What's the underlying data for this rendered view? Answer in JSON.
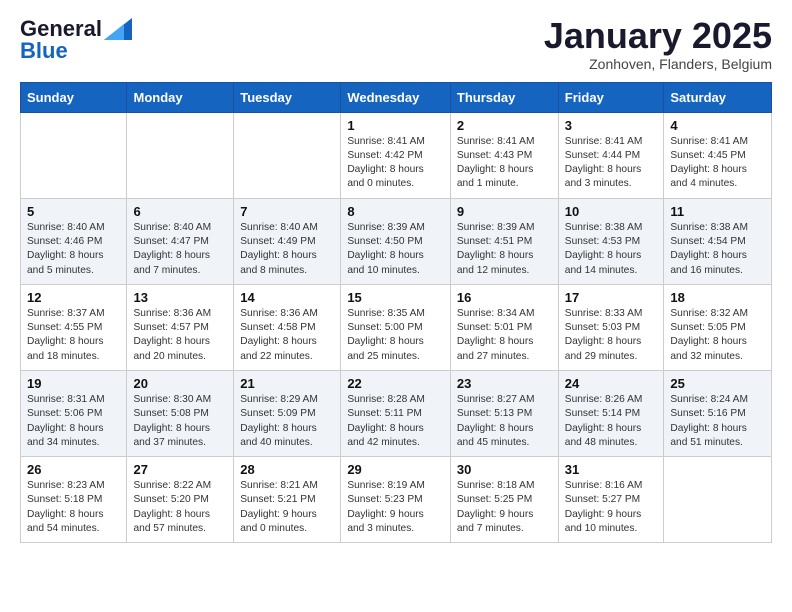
{
  "header": {
    "logo_general": "General",
    "logo_blue": "Blue",
    "month": "January 2025",
    "location": "Zonhoven, Flanders, Belgium"
  },
  "weekdays": [
    "Sunday",
    "Monday",
    "Tuesday",
    "Wednesday",
    "Thursday",
    "Friday",
    "Saturday"
  ],
  "weeks": [
    [
      {
        "day": "",
        "info": ""
      },
      {
        "day": "",
        "info": ""
      },
      {
        "day": "",
        "info": ""
      },
      {
        "day": "1",
        "info": "Sunrise: 8:41 AM\nSunset: 4:42 PM\nDaylight: 8 hours\nand 0 minutes."
      },
      {
        "day": "2",
        "info": "Sunrise: 8:41 AM\nSunset: 4:43 PM\nDaylight: 8 hours\nand 1 minute."
      },
      {
        "day": "3",
        "info": "Sunrise: 8:41 AM\nSunset: 4:44 PM\nDaylight: 8 hours\nand 3 minutes."
      },
      {
        "day": "4",
        "info": "Sunrise: 8:41 AM\nSunset: 4:45 PM\nDaylight: 8 hours\nand 4 minutes."
      }
    ],
    [
      {
        "day": "5",
        "info": "Sunrise: 8:40 AM\nSunset: 4:46 PM\nDaylight: 8 hours\nand 5 minutes."
      },
      {
        "day": "6",
        "info": "Sunrise: 8:40 AM\nSunset: 4:47 PM\nDaylight: 8 hours\nand 7 minutes."
      },
      {
        "day": "7",
        "info": "Sunrise: 8:40 AM\nSunset: 4:49 PM\nDaylight: 8 hours\nand 8 minutes."
      },
      {
        "day": "8",
        "info": "Sunrise: 8:39 AM\nSunset: 4:50 PM\nDaylight: 8 hours\nand 10 minutes."
      },
      {
        "day": "9",
        "info": "Sunrise: 8:39 AM\nSunset: 4:51 PM\nDaylight: 8 hours\nand 12 minutes."
      },
      {
        "day": "10",
        "info": "Sunrise: 8:38 AM\nSunset: 4:53 PM\nDaylight: 8 hours\nand 14 minutes."
      },
      {
        "day": "11",
        "info": "Sunrise: 8:38 AM\nSunset: 4:54 PM\nDaylight: 8 hours\nand 16 minutes."
      }
    ],
    [
      {
        "day": "12",
        "info": "Sunrise: 8:37 AM\nSunset: 4:55 PM\nDaylight: 8 hours\nand 18 minutes."
      },
      {
        "day": "13",
        "info": "Sunrise: 8:36 AM\nSunset: 4:57 PM\nDaylight: 8 hours\nand 20 minutes."
      },
      {
        "day": "14",
        "info": "Sunrise: 8:36 AM\nSunset: 4:58 PM\nDaylight: 8 hours\nand 22 minutes."
      },
      {
        "day": "15",
        "info": "Sunrise: 8:35 AM\nSunset: 5:00 PM\nDaylight: 8 hours\nand 25 minutes."
      },
      {
        "day": "16",
        "info": "Sunrise: 8:34 AM\nSunset: 5:01 PM\nDaylight: 8 hours\nand 27 minutes."
      },
      {
        "day": "17",
        "info": "Sunrise: 8:33 AM\nSunset: 5:03 PM\nDaylight: 8 hours\nand 29 minutes."
      },
      {
        "day": "18",
        "info": "Sunrise: 8:32 AM\nSunset: 5:05 PM\nDaylight: 8 hours\nand 32 minutes."
      }
    ],
    [
      {
        "day": "19",
        "info": "Sunrise: 8:31 AM\nSunset: 5:06 PM\nDaylight: 8 hours\nand 34 minutes."
      },
      {
        "day": "20",
        "info": "Sunrise: 8:30 AM\nSunset: 5:08 PM\nDaylight: 8 hours\nand 37 minutes."
      },
      {
        "day": "21",
        "info": "Sunrise: 8:29 AM\nSunset: 5:09 PM\nDaylight: 8 hours\nand 40 minutes."
      },
      {
        "day": "22",
        "info": "Sunrise: 8:28 AM\nSunset: 5:11 PM\nDaylight: 8 hours\nand 42 minutes."
      },
      {
        "day": "23",
        "info": "Sunrise: 8:27 AM\nSunset: 5:13 PM\nDaylight: 8 hours\nand 45 minutes."
      },
      {
        "day": "24",
        "info": "Sunrise: 8:26 AM\nSunset: 5:14 PM\nDaylight: 8 hours\nand 48 minutes."
      },
      {
        "day": "25",
        "info": "Sunrise: 8:24 AM\nSunset: 5:16 PM\nDaylight: 8 hours\nand 51 minutes."
      }
    ],
    [
      {
        "day": "26",
        "info": "Sunrise: 8:23 AM\nSunset: 5:18 PM\nDaylight: 8 hours\nand 54 minutes."
      },
      {
        "day": "27",
        "info": "Sunrise: 8:22 AM\nSunset: 5:20 PM\nDaylight: 8 hours\nand 57 minutes."
      },
      {
        "day": "28",
        "info": "Sunrise: 8:21 AM\nSunset: 5:21 PM\nDaylight: 9 hours\nand 0 minutes."
      },
      {
        "day": "29",
        "info": "Sunrise: 8:19 AM\nSunset: 5:23 PM\nDaylight: 9 hours\nand 3 minutes."
      },
      {
        "day": "30",
        "info": "Sunrise: 8:18 AM\nSunset: 5:25 PM\nDaylight: 9 hours\nand 7 minutes."
      },
      {
        "day": "31",
        "info": "Sunrise: 8:16 AM\nSunset: 5:27 PM\nDaylight: 9 hours\nand 10 minutes."
      },
      {
        "day": "",
        "info": ""
      }
    ]
  ]
}
